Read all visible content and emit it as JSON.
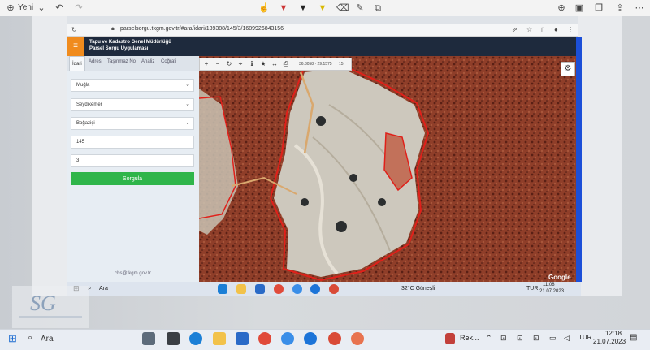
{
  "outer_toolbar": {
    "new_label": "Yeni",
    "icons": [
      "chevron-down-icon",
      "undo-icon",
      "redo-icon",
      "touch-icon",
      "pen-icon",
      "pen-icon",
      "highlighter-icon",
      "eraser-icon",
      "ruler-icon",
      "crop-icon",
      "zoom-in-icon",
      "save-icon",
      "copy-icon",
      "more-icon"
    ]
  },
  "browser": {
    "url": "parselsorgu.tkgm.gov.tr/#ara/idari/139388/145/3/1689926843156"
  },
  "app": {
    "title_line1": "Tapu ve Kadastro Genel Müdürlüğü",
    "title_line2": "Parsel Sorgu Uygulaması",
    "hamburger": "≡"
  },
  "sidebar": {
    "tabs": [
      "İdari",
      "Adres",
      "Taşınmaz No",
      "Analiz",
      "Coğrafi"
    ],
    "active_tab": "İdari",
    "province": "Muğla",
    "district": "Seydikemer",
    "neighborhood": "Boğaziçi",
    "block_no": "145",
    "parcel_no": "3",
    "query_button": "Sorgula",
    "email": "cbs@tkgm.gov.tr"
  },
  "map": {
    "coordinates": "36.3058 · 29.1575",
    "zoom": "15",
    "attribution": "Google",
    "colors": {
      "terrain": "#8a3b27",
      "parcel_outline": "#e0201a",
      "clearing": "#c7c2b6"
    }
  },
  "inner_taskbar": {
    "search": "Ara",
    "weather": "32°C  Güneşli",
    "lang": "TUR",
    "time": "11:08",
    "date": "21.07.2023"
  },
  "watermark": {
    "text": "S.G"
  },
  "taskbar": {
    "search": "Ara",
    "pinned_label": "Rek...",
    "lang": "TUR",
    "time": "12:18",
    "date": "21.07.2023"
  }
}
